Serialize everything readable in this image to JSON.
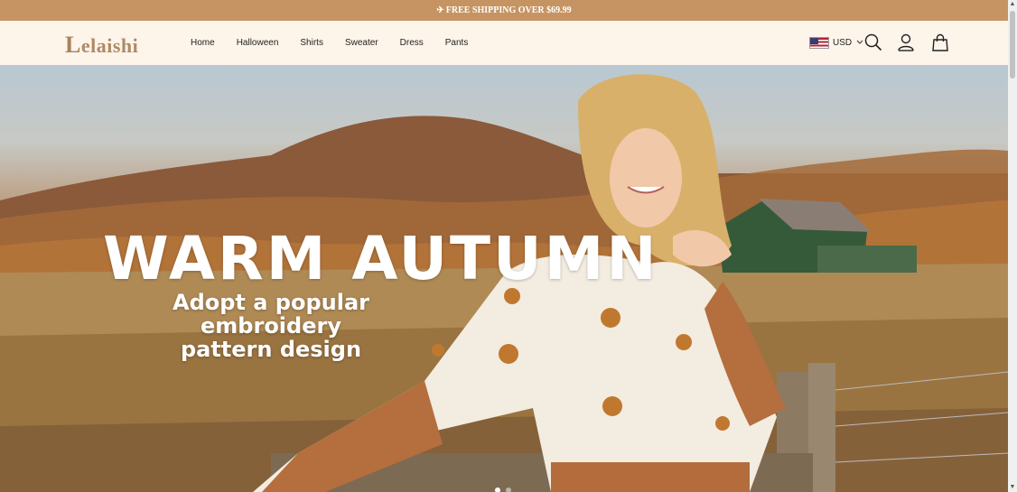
{
  "announcement": {
    "icon": "airplane-icon",
    "text": "FREE SHIPPING OVER $69.99"
  },
  "header": {
    "logo": {
      "initial": "L",
      "rest": "elaishi"
    },
    "nav": [
      "Home",
      "Halloween",
      "Shirts",
      "Sweater",
      "Dress",
      "Pants"
    ],
    "currency": "USD",
    "icons": [
      "us-flag-icon",
      "chevron-down-icon",
      "search-icon",
      "user-icon",
      "shopping-bag-icon"
    ]
  },
  "hero": {
    "title": "WARM AUTUMN",
    "subtitle_line1": "Adopt a popular embroidery",
    "subtitle_line2": "pattern design",
    "slides": 2,
    "active_slide": 1
  },
  "colors": {
    "announce_bg": "#c69463",
    "header_bg": "#fdf4ea",
    "logo": "#b08a63",
    "text": "#222222"
  }
}
